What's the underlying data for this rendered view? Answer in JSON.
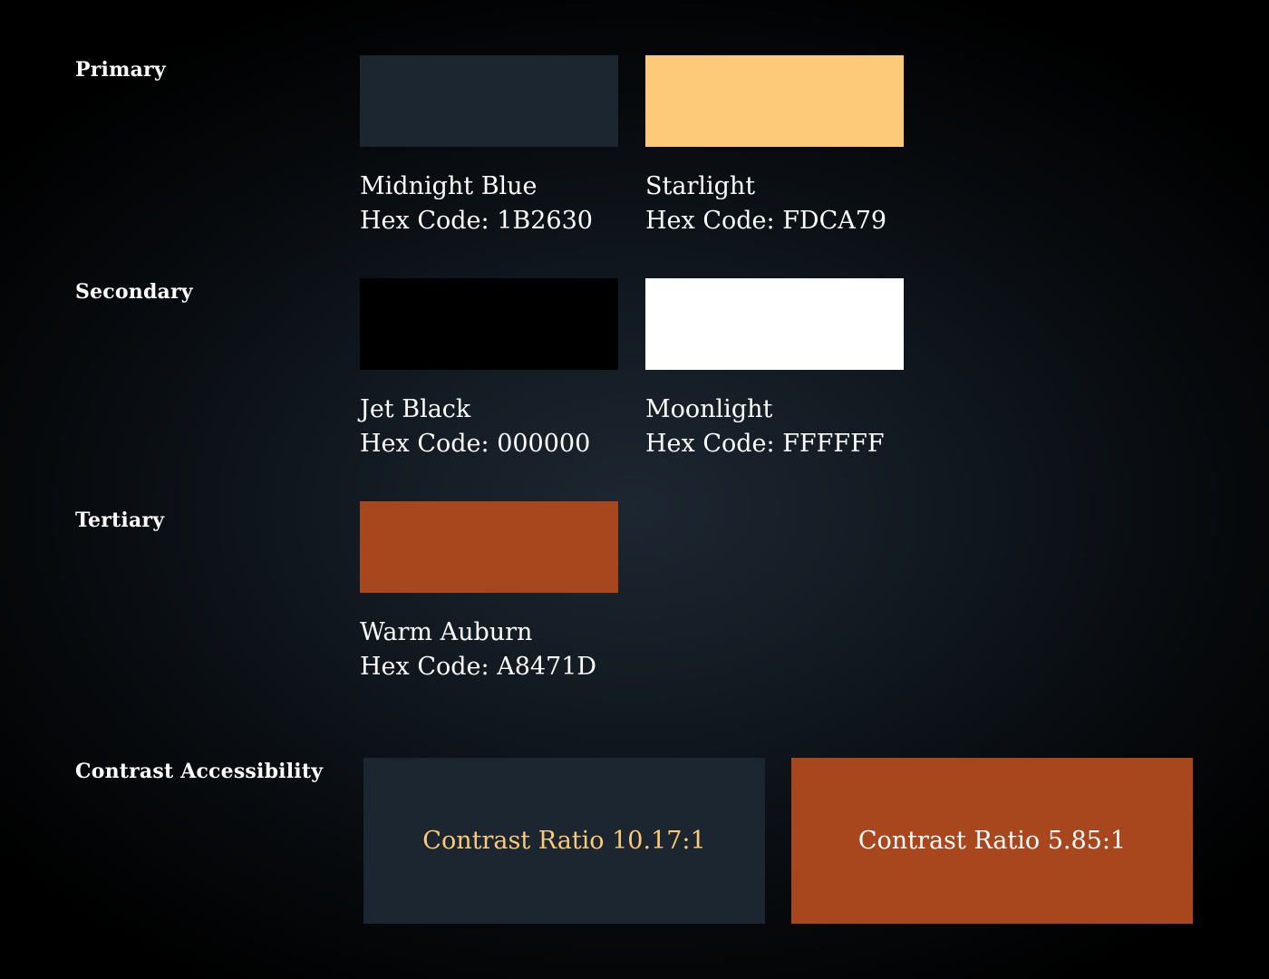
{
  "sections": {
    "primary": "Primary",
    "secondary": "Secondary",
    "tertiary": "Tertiary",
    "contrast": "Contrast Accessibility"
  },
  "colors": {
    "midnight_blue": {
      "name": "Midnight Blue",
      "hex_label": "Hex Code: 1B2630",
      "hex": "#1B2630"
    },
    "starlight": {
      "name": "Starlight",
      "hex_label": "Hex Code: FDCA79",
      "hex": "#FDCA79"
    },
    "jet_black": {
      "name": "Jet Black",
      "hex_label": "Hex Code: 000000",
      "hex": "#000000"
    },
    "moonlight": {
      "name": "Moonlight",
      "hex_label": "Hex Code: FFFFFF",
      "hex": "#FFFFFF"
    },
    "warm_auburn": {
      "name": "Warm Auburn",
      "hex_label": "Hex Code: A8471D",
      "hex": "#A8471D"
    }
  },
  "contrast": {
    "sample_1": {
      "text": "Contrast Ratio 10.17:1",
      "background": "#1B2630",
      "foreground": "#FDCA79"
    },
    "sample_2": {
      "text": "Contrast Ratio 5.85:1",
      "background": "#A8471D",
      "foreground": "#FFFFFF"
    }
  }
}
